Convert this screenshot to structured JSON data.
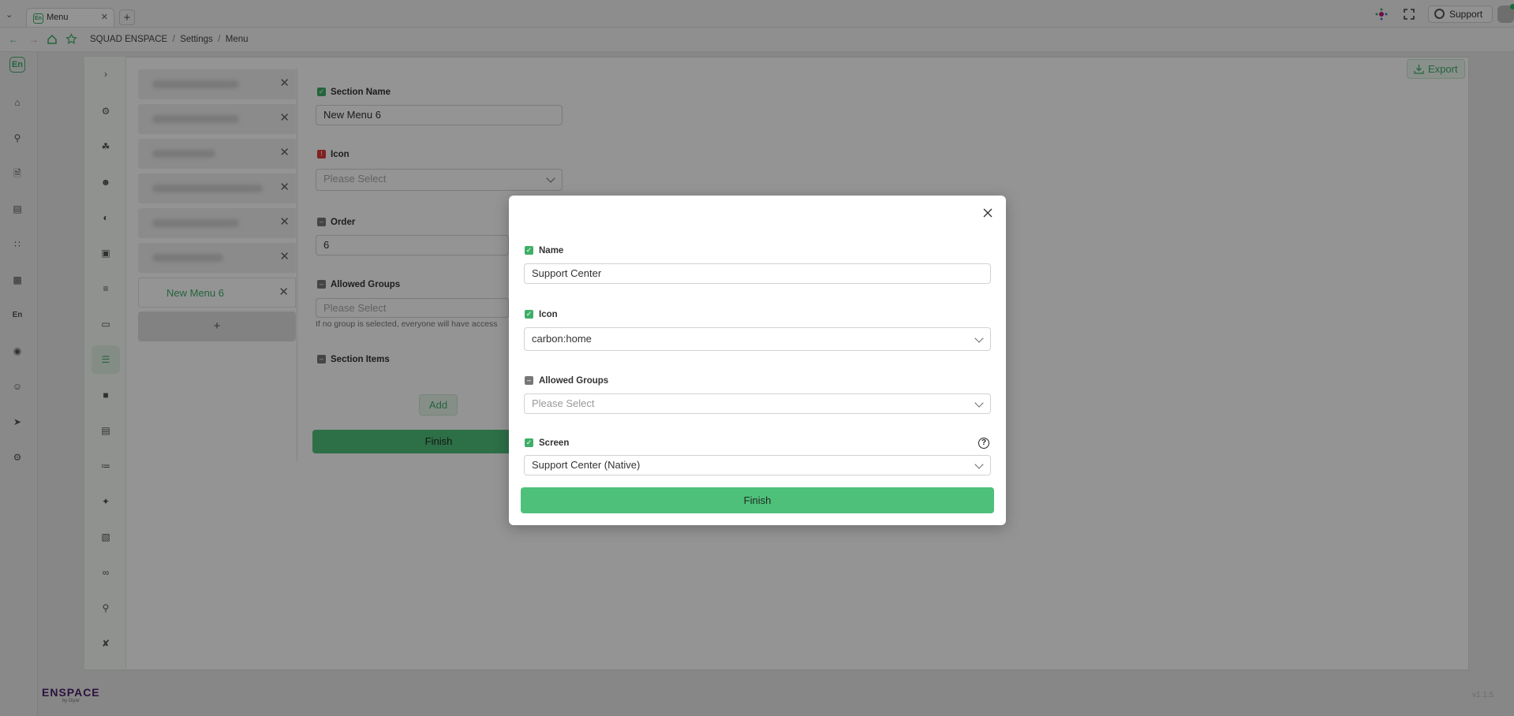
{
  "browser": {
    "tab_title": "Menu",
    "tab_icon_text": "En",
    "new_tab": "+",
    "support_label": "Support",
    "breadcrumb": [
      "SQUAD ENSPACE",
      "Settings",
      "Menu"
    ]
  },
  "rail": {
    "logo_text": "En",
    "mid_text": "En",
    "icons": [
      "home-icon",
      "location-icon",
      "document-icon",
      "calendar-icon",
      "grid-icon",
      "cards-icon",
      "en-text",
      "pin-icon",
      "user-icon",
      "rocket-icon",
      "settings-icon"
    ]
  },
  "brand": {
    "name": "ENSPACE",
    "tagline": "by Diyar"
  },
  "version": "v1.1.5",
  "header": {
    "export_label": "Export"
  },
  "menu_list": {
    "selected_label": "New Menu 6",
    "add_label": "+"
  },
  "form": {
    "section_name_label": "Section Name",
    "section_name_value": "New Menu 6",
    "icon_label": "Icon",
    "icon_placeholder": "Please Select",
    "order_label": "Order",
    "order_value": "6",
    "groups_label": "Allowed Groups",
    "groups_placeholder": "Please Select",
    "groups_hint": "If no group is selected, everyone will have access",
    "items_label": "Section Items",
    "add_label": "Add",
    "finish_label": "Finish"
  },
  "modal": {
    "name_label": "Name",
    "name_value": "Support Center",
    "icon_label": "Icon",
    "icon_value": "carbon:home",
    "groups_label": "Allowed Groups",
    "groups_placeholder": "Please Select",
    "screen_label": "Screen",
    "screen_value": "Support Center (Native)",
    "help_symbol": "?",
    "finish_label": "Finish"
  }
}
